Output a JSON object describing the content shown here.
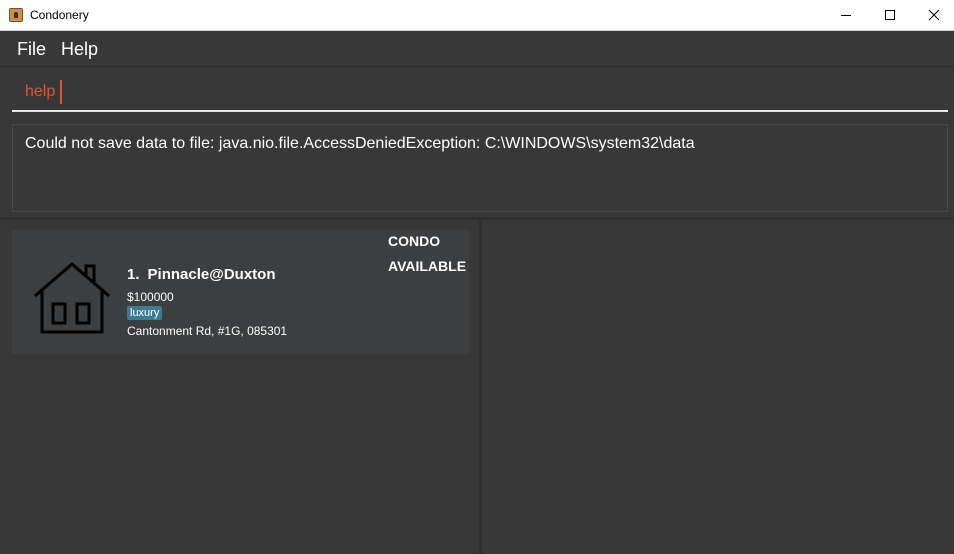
{
  "window": {
    "title": "Condonery"
  },
  "menu": {
    "file": "File",
    "help": "Help"
  },
  "command": {
    "value": "help"
  },
  "result": {
    "message": "Could not save data to file: java.nio.file.AccessDeniedException: C:\\WINDOWS\\system32\\data"
  },
  "properties": [
    {
      "index": "1.",
      "name": "Pinnacle@Duxton",
      "price": "$100000",
      "tag": "luxury",
      "address": "Cantonment Rd, #1G, 085301",
      "type": "CONDO",
      "status": "AVAILABLE",
      "icon": "house-icon"
    }
  ],
  "colors": {
    "background": "#383838",
    "command_text": "#d9593a",
    "tag": "#3e7b91",
    "card": "#3c3e40"
  }
}
